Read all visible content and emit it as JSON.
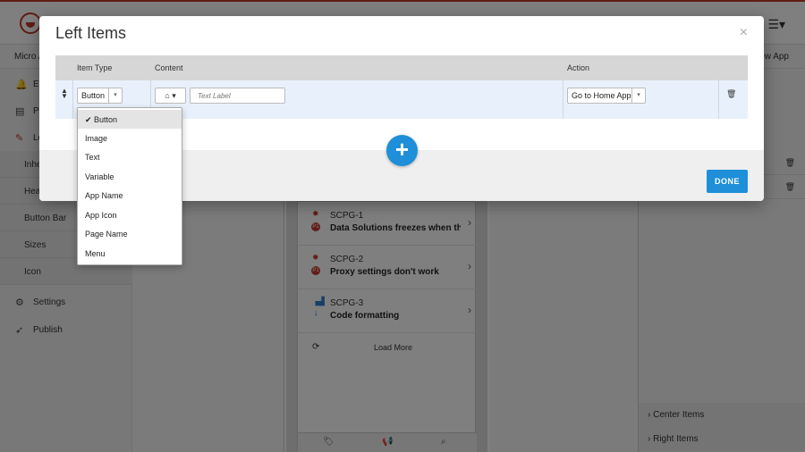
{
  "app": {
    "subbar_left": "Micro A",
    "subbar_right": "ew App",
    "sidebar": [
      {
        "label": "Ev",
        "icon": "bell-icon"
      },
      {
        "label": "Pa",
        "icon": "pages-icon"
      },
      {
        "label": "Lo",
        "icon": "brush-icon"
      },
      {
        "label": "Inhe",
        "sub": true
      },
      {
        "label": "Hea",
        "sub": true
      },
      {
        "label": "Button Bar",
        "sub": true
      },
      {
        "label": "Sizes",
        "sub": true
      },
      {
        "label": "Icon",
        "sub": true
      },
      {
        "label": "Settings",
        "icon": "gear-icon"
      },
      {
        "label": "Publish",
        "icon": "rocket-icon"
      }
    ],
    "issues": [
      {
        "key": "SCPG-1",
        "title": "Data Solutions freezes when ther",
        "priority": "P1"
      },
      {
        "key": "SCPG-2",
        "title": "Proxy settings don't work",
        "priority": "P1"
      },
      {
        "key": "SCPG-3",
        "title": "Code formatting",
        "priority": "low"
      }
    ],
    "load_more": "Load More",
    "right_sections": [
      "Center Items",
      "Right Items"
    ]
  },
  "modal": {
    "title": "Left Items",
    "close": "×",
    "columns": {
      "item_type": "Item Type",
      "content": "Content",
      "action": "Action"
    },
    "row": {
      "item_type": "Button",
      "icon": "home-icon",
      "text_placeholder": "Text Label",
      "action": "Go to Home App"
    },
    "add": "+",
    "done": "DONE",
    "dropdown": [
      {
        "label": "✔ Button",
        "selected": true
      },
      {
        "label": "Image"
      },
      {
        "label": "Text"
      },
      {
        "label": "Variable"
      },
      {
        "label": "App Name"
      },
      {
        "label": "App Icon"
      },
      {
        "label": "Page Name"
      },
      {
        "label": "Menu"
      }
    ]
  },
  "colors": {
    "accent": "#1e8fd8",
    "brand": "#c0392b"
  }
}
